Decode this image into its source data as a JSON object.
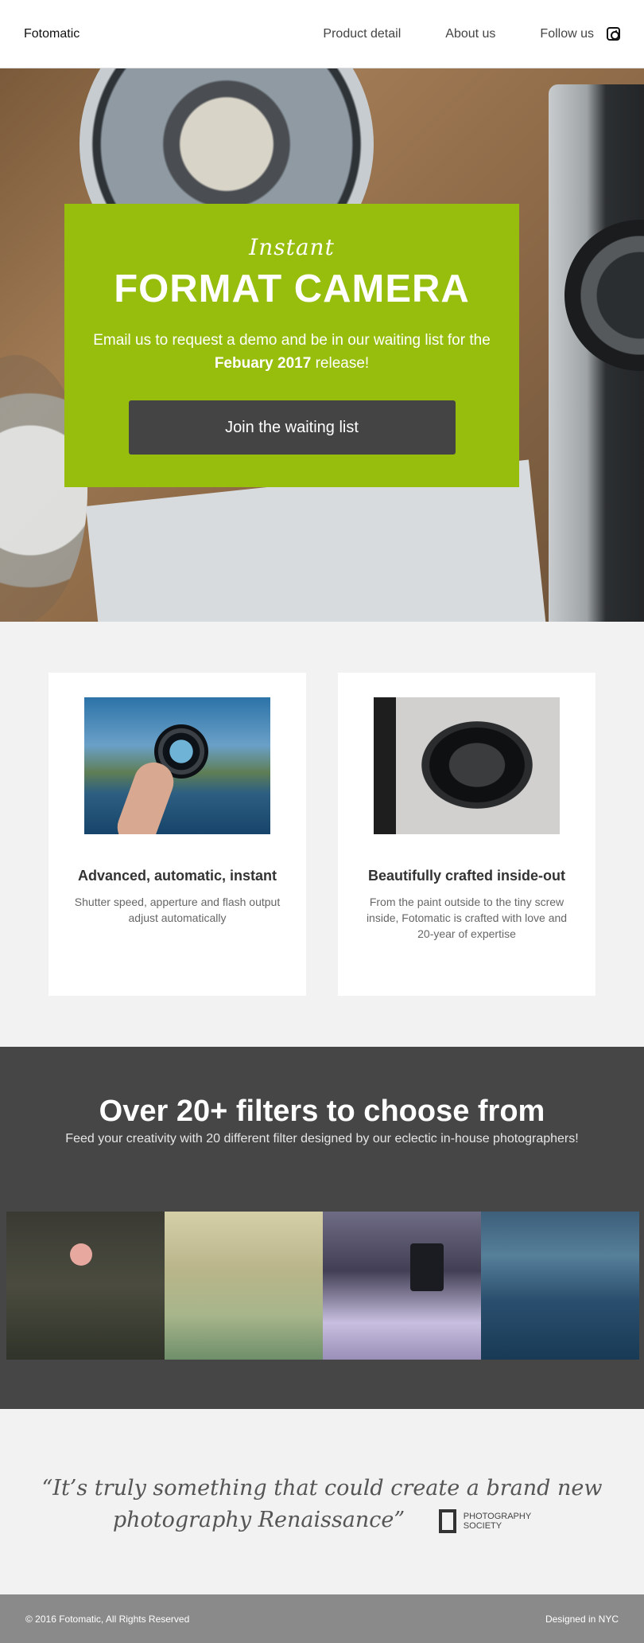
{
  "nav": {
    "brand": "Fotomatic",
    "links": [
      "Product detail",
      "About us",
      "Follow us"
    ],
    "follow_icon": "instagram-icon"
  },
  "hero": {
    "eyebrow": "Instant",
    "title": "FORMAT CAMERA",
    "text_before": "Email us to request a demo and be in our waiting list for the ",
    "text_bold": "Febuary 2017",
    "text_after": " release!",
    "cta_label": "Join the waiting list",
    "card_color": "#97be0d"
  },
  "features": [
    {
      "title": "Advanced, automatic, instant",
      "text": "Shutter speed, apperture and flash output adjust automatically"
    },
    {
      "title": "Beautifully crafted inside-out",
      "text": "From the paint outside to the tiny screw inside, Fotomatic is crafted with love and 20-year of expertise"
    }
  ],
  "filters": {
    "title": "Over 20+ filters to choose from",
    "subtitle": "Feed your creativity with 20 different filter designed by our eclectic in-house photographers!"
  },
  "quote": {
    "text": "“It’s truly something that could create a brand new photography Renaissance”",
    "source_line1": "PHOTOGRAPHY",
    "source_line2": "SOCIETY"
  },
  "footer": {
    "copyright": "© 2016 Fotomatic, All Rights Reserved",
    "credit": "Designed in NYC"
  }
}
